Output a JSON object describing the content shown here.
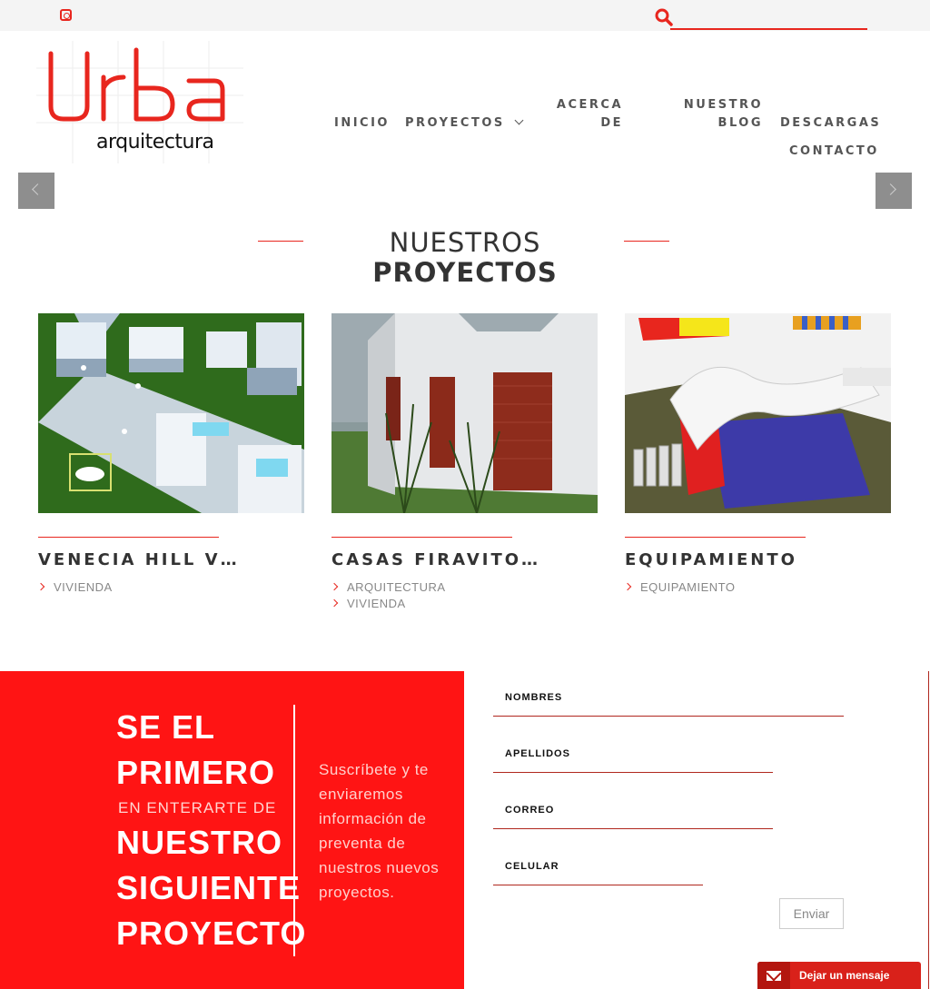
{
  "topbar": {
    "search_placeholder": ""
  },
  "logo": {
    "brand": "Urba",
    "sub": "arquitectura"
  },
  "nav": {
    "inicio": "INICIO",
    "proyectos": "PROYECTOS",
    "acerca_1": "ACERCA",
    "acerca_2": "DE",
    "blog_1": "NUESTRO",
    "blog_2": "BLOG",
    "descargas": "DESCARGAS",
    "contacto": "CONTACTO"
  },
  "section": {
    "title_light": "NUESTROS",
    "title_bold": "PROYECTOS"
  },
  "projects": [
    {
      "title": "VENECIA HILL V…",
      "tags": [
        "VIVIENDA"
      ]
    },
    {
      "title": "CASAS FIRAVITO…",
      "tags": [
        "ARQUITECTURA",
        "VIVIENDA"
      ]
    },
    {
      "title": "EQUIPAMIENTO",
      "tags": [
        "EQUIPAMIENTO"
      ]
    }
  ],
  "promo": {
    "line1": "SE EL",
    "line2": "PRIMERO",
    "line3": "EN ENTERARTE DE",
    "line4": "NUESTRO",
    "line5": "SIGUIENTE",
    "line6": "PROYECTO",
    "subtitle": "Suscríbete y te enviaremos información de preventa de nuestros nuevos proyectos."
  },
  "form": {
    "nombres": "NOMBRES",
    "apellidos": "APELLIDOS",
    "correo": "CORREO",
    "celular": "CELULAR",
    "submit": "Enviar"
  },
  "chat": {
    "label": "Dejar un mensaje"
  },
  "colors": {
    "accent": "#e8261e",
    "panel": "#ff1414"
  }
}
